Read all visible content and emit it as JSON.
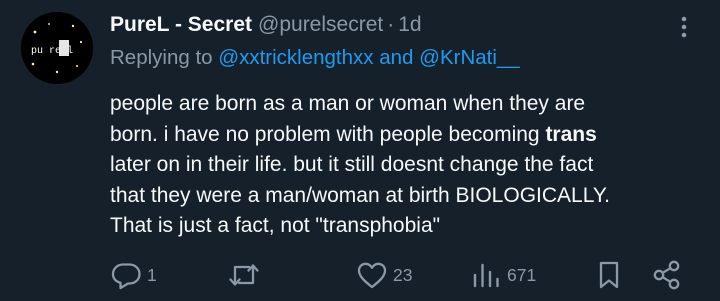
{
  "tweet": {
    "display_name": "PureL - Secret",
    "handle": "@purelsecret",
    "separator": "·",
    "time": "1d",
    "avatar_text": "pu re l",
    "replying_prefix": "Replying to",
    "reply_mention_1": "@xxtricklengthxx",
    "reply_and": "and",
    "reply_mention_2": "@KrNati__",
    "body": {
      "line1": "people are born as a man or woman when they are",
      "line2_pre": "born. i have no problem with people becoming ",
      "line2_bold": "trans",
      "line3": "later on in their life. but it still doesnt change the fact",
      "line4": "that they were a man/woman at birth BIOLOGICALLY.",
      "line5": "That is just a fact, not \"transphobia\""
    }
  },
  "actions": {
    "reply_count": "1",
    "retweet_count": "",
    "like_count": "23",
    "views_count": "671"
  },
  "colors": {
    "background": "#15202b",
    "primary_text": "#f7f9f9",
    "secondary_text": "#8b98a5",
    "link": "#1d9bf0"
  }
}
